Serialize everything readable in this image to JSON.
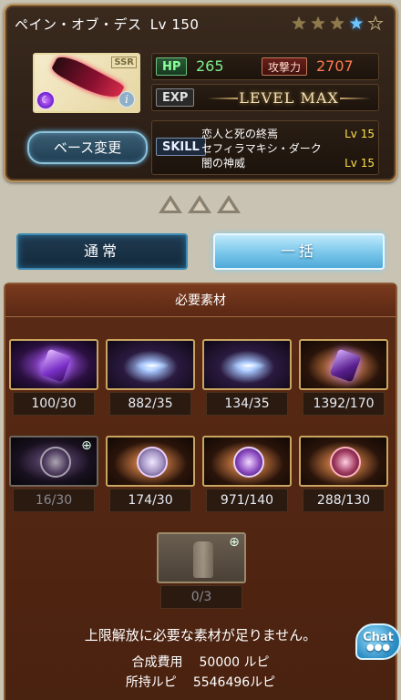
{
  "weapon": {
    "name": "ペイン・オブ・デス",
    "level_label": "Lv",
    "level": "150",
    "rarity": "SSR",
    "stars": [
      "gold",
      "gold",
      "gold",
      "blue",
      "empty"
    ],
    "hp_label": "HP",
    "hp": "265",
    "atk_label": "攻撃力",
    "atk": "2707",
    "exp_label": "EXP",
    "exp_status": "LEVEL MAX",
    "skill_label": "SKILL",
    "skills": [
      {
        "name": "恋人と死の終焉",
        "level": "Lv  15"
      },
      {
        "name": "セフィラマキシ・ダーク",
        "level": ""
      },
      {
        "name": "闇の神威",
        "level": "Lv  15"
      }
    ],
    "base_change_label": "ベース変更",
    "element_icon": "dark-element-icon",
    "info_icon": "info-icon"
  },
  "modes": {
    "normal_label": "通常",
    "bulk_label": "一括"
  },
  "materials_panel": {
    "title": "必要素材",
    "items": [
      {
        "count": "100/30",
        "style": "violet-gem",
        "zoom": false
      },
      {
        "count": "882/35",
        "style": "blue-spark",
        "zoom": false
      },
      {
        "count": "134/35",
        "style": "blue-spark",
        "zoom": false
      },
      {
        "count": "1392/170",
        "style": "warm-gem",
        "zoom": false
      },
      {
        "count": "16/30",
        "style": "dim-orb",
        "zoom": true
      },
      {
        "count": "174/30",
        "style": "warm-cluster",
        "zoom": false
      },
      {
        "count": "971/140",
        "style": "violet-orb",
        "zoom": false
      },
      {
        "count": "288/130",
        "style": "warm-orb",
        "zoom": false
      },
      {
        "count": "0/3",
        "style": "stone",
        "zoom": true
      }
    ],
    "notice": "上限解放に必要な素材が足りません。",
    "cost_label": "合成費用",
    "cost_value": "50000 ルピ",
    "owned_label": "所持ルピ",
    "owned_value": "5546496ルピ"
  },
  "chat": {
    "label": "Chat",
    "dots": "●●●"
  },
  "colors": {
    "hp": "#7df08c",
    "atk": "#ff7a50",
    "skill_level": "#ffe04a",
    "panel": "#5a2a14",
    "accent_blue": "#4ea9d8"
  }
}
